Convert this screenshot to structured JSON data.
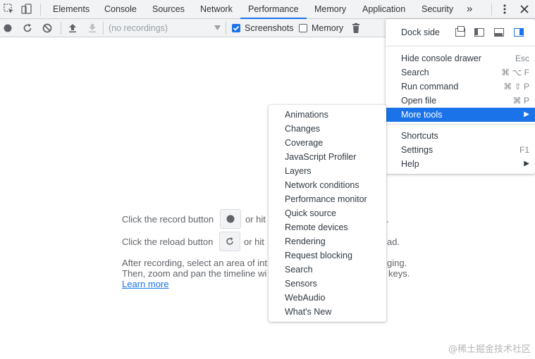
{
  "tabs": {
    "items": [
      "Elements",
      "Console",
      "Sources",
      "Network",
      "Performance",
      "Memory",
      "Application",
      "Security"
    ],
    "active": "Performance",
    "overflow": "»"
  },
  "toolbar": {
    "recordings_placeholder": "(no recordings)",
    "screenshots_label": "Screenshots",
    "screenshots_checked": true,
    "memory_label": "Memory",
    "memory_checked": false
  },
  "landing": {
    "record_line_prefix": "Click the record button",
    "record_line_or": "or hit",
    "record_line_tail": ".",
    "reload_line_prefix": "Click the reload button",
    "reload_line_or": "or hit",
    "reload_line_tail": "ad.",
    "after_line1_start": "After recording, select an area of int",
    "after_line1_end": "ging.",
    "after_line2_start": "Then, zoom and pan the timeline wi",
    "after_line2_end": "keys.",
    "learn_more": "Learn more"
  },
  "main_menu": {
    "dock_side_label": "Dock side",
    "items_group1": [
      {
        "label": "Hide console drawer",
        "shortcut": "Esc"
      },
      {
        "label": "Search",
        "shortcut": "⌘ ⌥ F"
      },
      {
        "label": "Run command",
        "shortcut": "⌘ ⇧ P"
      },
      {
        "label": "Open file",
        "shortcut": "⌘ P"
      }
    ],
    "more_tools": {
      "label": "More tools",
      "arrow": "▶"
    },
    "items_group2": [
      {
        "label": "Shortcuts",
        "shortcut": ""
      },
      {
        "label": "Settings",
        "shortcut": "F1"
      },
      {
        "label": "Help",
        "shortcut": "▶"
      }
    ]
  },
  "more_tools_menu": {
    "items": [
      "Animations",
      "Changes",
      "Coverage",
      "JavaScript Profiler",
      "Layers",
      "Network conditions",
      "Performance monitor",
      "Quick source",
      "Remote devices",
      "Rendering",
      "Request blocking",
      "Search",
      "Sensors",
      "WebAudio",
      "What's New"
    ]
  },
  "watermark": "@稀土掘金技术社区",
  "colors": {
    "accent": "#1a73e8",
    "toolbar_bg": "#f1f3f4",
    "text": "#303942"
  }
}
